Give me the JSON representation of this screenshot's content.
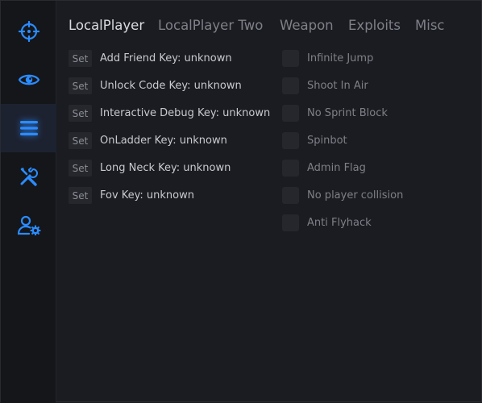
{
  "colors": {
    "accent": "#2b8cff",
    "background": "#1b1c21",
    "sidebar": "#15161a"
  },
  "sidebar": {
    "items": [
      {
        "icon": "crosshair-icon",
        "active": false
      },
      {
        "icon": "eye-icon",
        "active": false
      },
      {
        "icon": "menu-lines-icon",
        "active": true
      },
      {
        "icon": "wrench-screwdriver-icon",
        "active": false
      },
      {
        "icon": "user-settings-icon",
        "active": false
      }
    ]
  },
  "tabs": [
    {
      "label": "LocalPlayer",
      "active": true
    },
    {
      "label": "LocalPlayer Two",
      "active": false
    },
    {
      "label": "Weapon",
      "active": false
    },
    {
      "label": "Exploits",
      "active": false
    },
    {
      "label": "Misc",
      "active": false
    }
  ],
  "keybinds": [
    {
      "button": "Set",
      "label": "Add Friend Key: unknown"
    },
    {
      "button": "Set",
      "label": "Unlock Code Key: unknown"
    },
    {
      "button": "Set",
      "label": "Interactive Debug Key: unknown"
    },
    {
      "button": "Set",
      "label": "OnLadder Key: unknown"
    },
    {
      "button": "Set",
      "label": "Long Neck Key: unknown"
    },
    {
      "button": "Set",
      "label": "Fov Key: unknown"
    }
  ],
  "toggles": [
    {
      "label": "Infinite Jump",
      "checked": false
    },
    {
      "label": "Shoot In Air",
      "checked": false
    },
    {
      "label": "No Sprint Block",
      "checked": false
    },
    {
      "label": "Spinbot",
      "checked": false
    },
    {
      "label": "Admin Flag",
      "checked": false
    },
    {
      "label": "No player collision",
      "checked": false
    },
    {
      "label": "Anti Flyhack",
      "checked": false
    }
  ]
}
